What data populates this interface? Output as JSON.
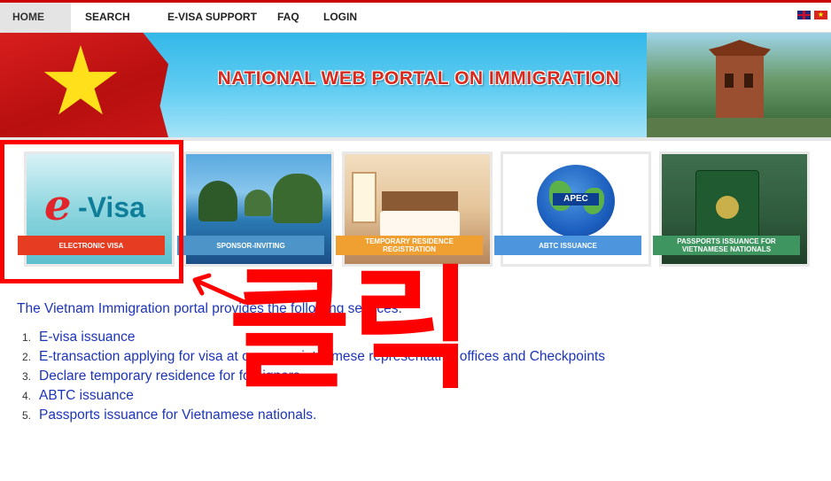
{
  "nav": {
    "items": [
      {
        "label": "HOME",
        "active": true
      },
      {
        "label": "SEARCH"
      },
      {
        "label": "E-VISA SUPPORT"
      },
      {
        "label": "FAQ"
      },
      {
        "label": "LOGIN"
      }
    ],
    "languages": [
      "english-flag-icon",
      "vietnam-flag-icon"
    ]
  },
  "banner": {
    "title": "NATIONAL WEB PORTAL ON IMMIGRATION"
  },
  "cards": [
    {
      "image_text_e": "e",
      "image_text_rest": "-Visa",
      "label": "ELECTRONIC VISA",
      "color": "#e53c22"
    },
    {
      "label": "SPONSOR-INVITING",
      "color": "#4d95c9"
    },
    {
      "label": "TEMPORARY RESIDENCE REGISTRATION",
      "color": "#f0a030"
    },
    {
      "image_text": "APEC",
      "label": "ABTC ISSUANCE",
      "color": "#4d95dc"
    },
    {
      "label": "PASSPORTS ISSUANCE FOR VIETNAMESE NATIONALS",
      "color": "#3f9560"
    }
  ],
  "intro": "The Vietnam Immigration portal provides the following services:",
  "services": [
    {
      "num": "1.",
      "text": "E-visa issuance"
    },
    {
      "num": "2.",
      "text": "E-transaction applying for visa at oversea vietnamese representative offices and Checkpoints"
    },
    {
      "num": "3.",
      "text": "Declare temporary residence for foreigners"
    },
    {
      "num": "4.",
      "text": "ABTC issuance"
    },
    {
      "num": "5.",
      "text": "Passports issuance for Vietnamese nationals."
    }
  ],
  "annotation": {
    "text": "클릭",
    "color": "#ff0000"
  }
}
